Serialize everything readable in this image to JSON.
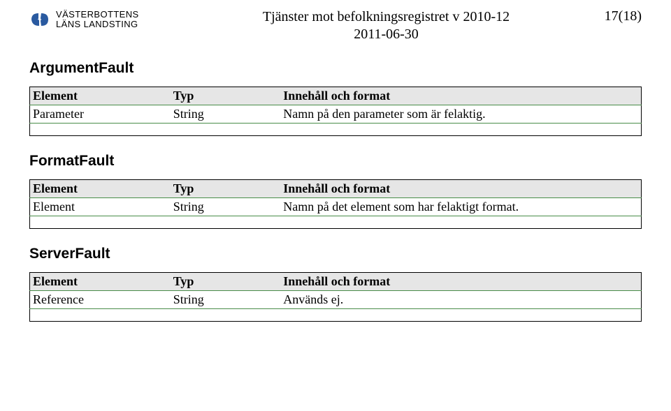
{
  "header": {
    "org_line1": "VÄSTERBOTTENS",
    "org_line2": "LÄNS LANDSTING",
    "title_line1": "Tjänster mot befolkningsregistret v 2010-12",
    "title_line2": "2011-06-30",
    "page_number": "17(18)"
  },
  "sections": [
    {
      "title": "ArgumentFault",
      "columns": [
        "Element",
        "Typ",
        "Innehåll och format"
      ],
      "rows": [
        {
          "c1": "Parameter",
          "c2": "String",
          "c3": "Namn på den parameter som är felaktig."
        }
      ]
    },
    {
      "title": "FormatFault",
      "columns": [
        "Element",
        "Typ",
        "Innehåll och format"
      ],
      "rows": [
        {
          "c1": "Element",
          "c2": "String",
          "c3": "Namn på det element som har felaktigt format."
        }
      ]
    },
    {
      "title": "ServerFault",
      "columns": [
        "Element",
        "Typ",
        "Innehåll och format"
      ],
      "rows": [
        {
          "c1": "Reference",
          "c2": "String",
          "c3": "Används ej."
        }
      ]
    }
  ]
}
